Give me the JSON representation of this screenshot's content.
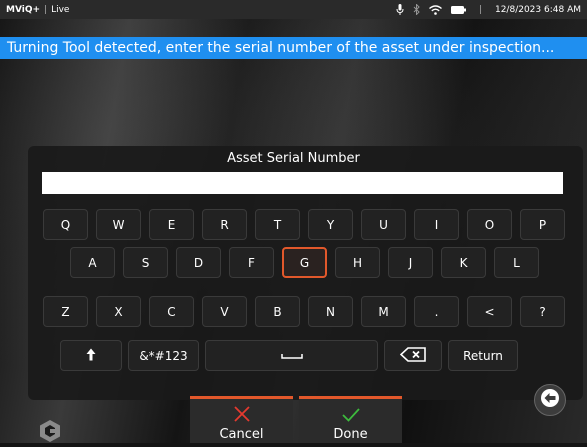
{
  "status_bar": {
    "app_name": "MViQ+",
    "separator": "|",
    "mode": "Live",
    "time_separator": "|",
    "datetime": "12/8/2023 6:48 AM",
    "icons": [
      "microphone-icon",
      "bluetooth-icon",
      "wifi-icon",
      "battery-icon"
    ]
  },
  "banner": {
    "message": "Turning Tool detected, enter the serial number of the asset under inspection..."
  },
  "dialog": {
    "title": "Asset Serial Number",
    "input_value": "",
    "input_placeholder": ""
  },
  "keyboard": {
    "selected_key": "G",
    "rows": [
      [
        "Q",
        "W",
        "E",
        "R",
        "T",
        "Y",
        "U",
        "I",
        "O",
        "P"
      ],
      [
        "A",
        "S",
        "D",
        "F",
        "G",
        "H",
        "J",
        "K",
        "L"
      ],
      [
        "Z",
        "X",
        "C",
        "V",
        "B",
        "N",
        "M",
        ".",
        "<",
        "?"
      ]
    ],
    "shift_icon": "arrow-up-icon",
    "symbols_label": "&*#123",
    "space_icon": "space-icon",
    "backspace_icon": "backspace-icon",
    "return_label": "Return"
  },
  "back_button": {
    "icon": "arrow-left-icon"
  },
  "actions": {
    "cancel_label": "Cancel",
    "done_label": "Done",
    "cancel_color": "#e53a2f",
    "done_color": "#3dbb3d"
  },
  "colors": {
    "accent": "#e2582b",
    "banner": "#1f8ff0"
  }
}
